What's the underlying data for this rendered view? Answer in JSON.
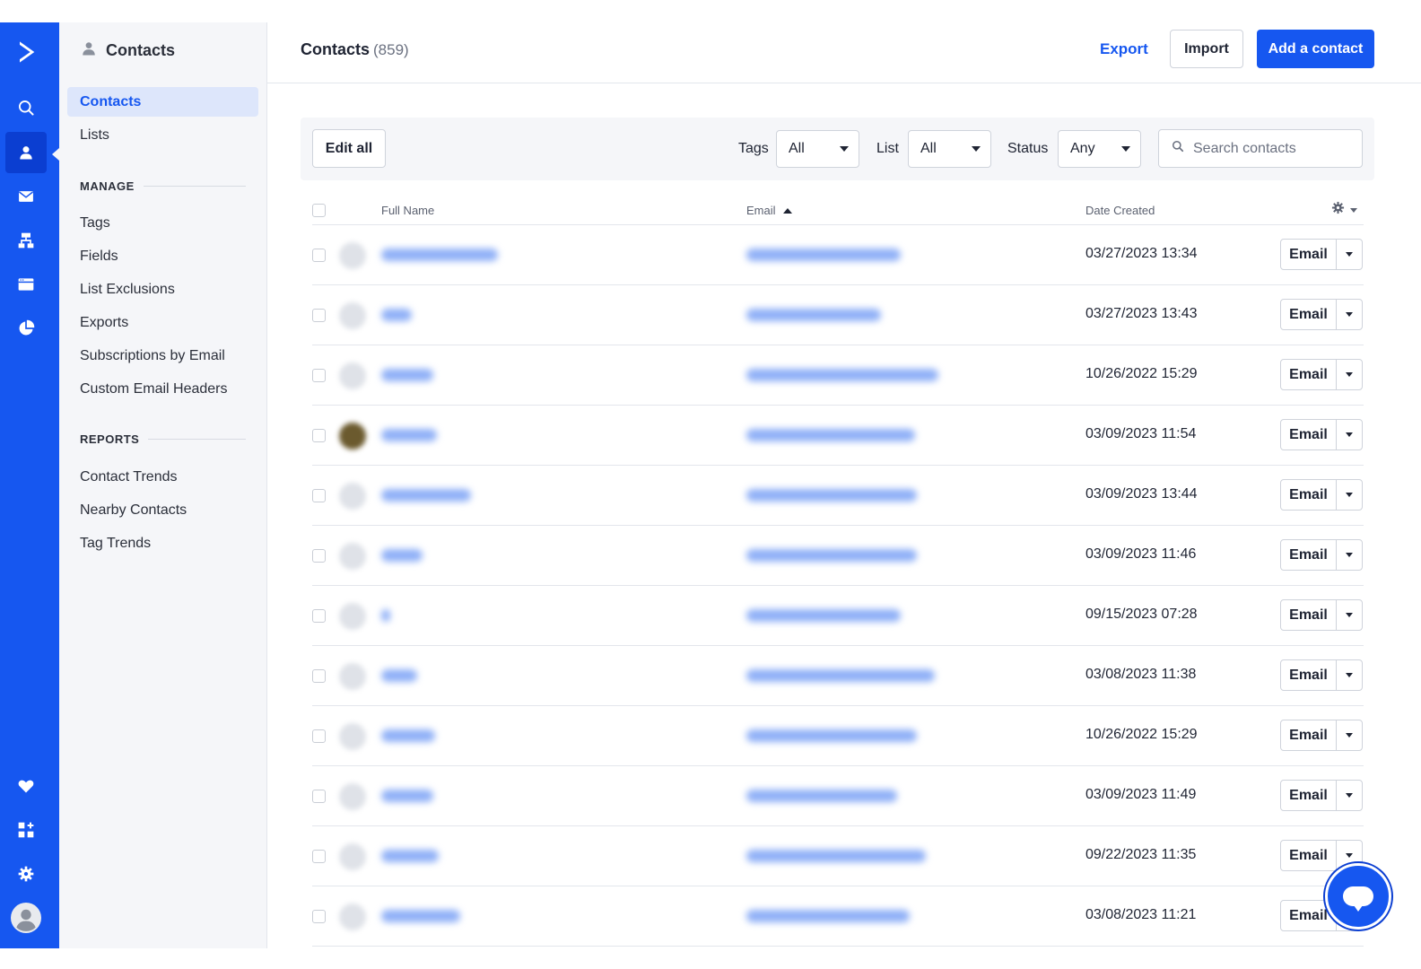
{
  "rail": {
    "items": [
      {
        "name": "logo-icon"
      },
      {
        "name": "search-icon"
      },
      {
        "name": "contacts-icon",
        "active": true
      },
      {
        "name": "email-icon"
      },
      {
        "name": "automations-icon"
      },
      {
        "name": "site-icon"
      },
      {
        "name": "reports-icon"
      },
      {
        "name": "heart-icon"
      },
      {
        "name": "apps-icon"
      },
      {
        "name": "settings-icon"
      },
      {
        "name": "user-avatar-icon"
      }
    ]
  },
  "subnav": {
    "title": "Contacts",
    "items": [
      {
        "label": "Contacts",
        "active": true
      },
      {
        "label": "Lists"
      }
    ],
    "manage_header": "MANAGE",
    "manage_items": [
      {
        "label": "Tags"
      },
      {
        "label": "Fields"
      },
      {
        "label": "List Exclusions"
      },
      {
        "label": "Exports"
      },
      {
        "label": "Subscriptions by Email"
      },
      {
        "label": "Custom Email Headers"
      }
    ],
    "reports_header": "REPORTS",
    "reports_items": [
      {
        "label": "Contact Trends"
      },
      {
        "label": "Nearby Contacts"
      },
      {
        "label": "Tag Trends"
      }
    ]
  },
  "header": {
    "title": "Contacts",
    "count": "(859)",
    "export_label": "Export",
    "import_label": "Import",
    "add_label": "Add a contact"
  },
  "filters": {
    "edit_all_label": "Edit all",
    "tags_label": "Tags",
    "tags_value": "All",
    "list_label": "List",
    "list_value": "All",
    "status_label": "Status",
    "status_value": "Any",
    "search_placeholder": "Search contacts"
  },
  "table": {
    "columns": {
      "full_name": "Full Name",
      "email": "Email",
      "date_created": "Date Created"
    },
    "sort_column": "Email",
    "sort_direction": "ascending",
    "row_action_label": "Email",
    "rows": [
      {
        "date": "03/27/2023 13:34"
      },
      {
        "date": "03/27/2023 13:43"
      },
      {
        "date": "10/26/2022 15:29"
      },
      {
        "date": "03/09/2023 11:54",
        "photo": true
      },
      {
        "date": "03/09/2023 13:44"
      },
      {
        "date": "03/09/2023 11:46"
      },
      {
        "date": "09/15/2023 07:28"
      },
      {
        "date": "03/08/2023 11:38"
      },
      {
        "date": "10/26/2022 15:29"
      },
      {
        "date": "03/09/2023 11:49"
      },
      {
        "date": "09/22/2023 11:35"
      },
      {
        "date": "03/08/2023 11:21"
      }
    ]
  },
  "colors": {
    "brand": "#1657f0",
    "rail_active": "#0b3ed1",
    "nav_active_bg": "#dde6fb"
  }
}
